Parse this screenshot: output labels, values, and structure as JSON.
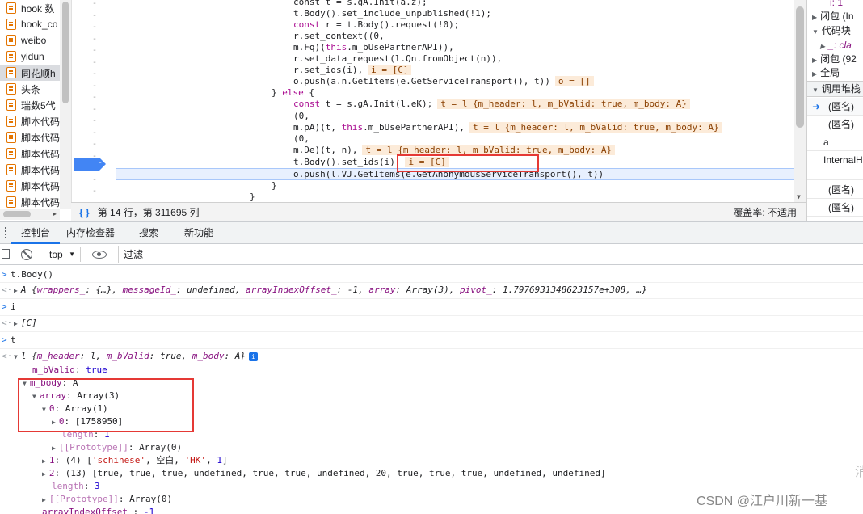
{
  "file_tree": {
    "items": [
      "hook 数",
      "hook_co",
      "weibo",
      "yidun",
      "同花顺h",
      "头条",
      "瑞数5代",
      "脚本代码",
      "脚本代码",
      "脚本代码",
      "脚本代码",
      "脚本代码",
      "脚本代码"
    ],
    "selected_index": 4
  },
  "gutter": {
    "marker": "-",
    "breakpoint_label": "-"
  },
  "code": {
    "line0": "const t = s.gA.Init(a.z);",
    "line1": "t.Body().set_include_unpublished(!1);",
    "line2_a": "const",
    "line2_b": " r = t.Body().request(!0);",
    "line3": "r.set_context((0,",
    "line4_a": "m.Fq)(",
    "line4_b": "this",
    "line4_c": ".m_bUsePartnerAPI)),",
    "line5": "r.set_data_request(l.Qn.fromObject(n)),",
    "line6": "r.set_ids(i),",
    "line6_inline": "i = [C]",
    "line7": "o.push(a.n.GetItems(e.GetServiceTransport(), t))",
    "line7_inline": "o = []",
    "line8_a": "} ",
    "line8_b": "else",
    "line8_c": " {",
    "line9_a": "const",
    "line9_b": " t = s.gA.Init(l.eK);",
    "line9_inline": "t = l {m_header: l, m_bValid: true, m_body: A}",
    "line10": "(0,",
    "line11_a": "m.pA)(t, ",
    "line11_b": "this",
    "line11_c": ".m_bUsePartnerAPI),",
    "line11_inline": "t = l {m_header: l, m_bValid: true, m_body: A}",
    "line12": "(0,",
    "line13": "m.De)(t, n),",
    "line13_inline": "t = l {m_header: l, m_bValid: true, m_body: A}",
    "line14": "t.Body().set_ids(i),",
    "line14_inline": "i = [C]",
    "line15": "o.push(l.VJ.GetItems(e.GetAnonymousServiceTransport(), t))",
    "line16": "}",
    "line17": "}"
  },
  "status_bar": {
    "position": "第 14 行，第 311695 列",
    "coverage": "覆盖率: 不适用"
  },
  "right_panel": {
    "scope_items": [
      {
        "label": "i: 1"
      },
      {
        "label": "闭包 (In"
      },
      {
        "label": "代码块"
      },
      {
        "label": "_: cla"
      },
      {
        "label": "闭包 (92"
      },
      {
        "label": "全局"
      }
    ],
    "call_stack_header": "调用堆栈",
    "call_stack": [
      "(匿名)",
      "(匿名)",
      "a",
      "InternalH",
      "(匿名)",
      "(匿名)"
    ]
  },
  "drawer_tabs": [
    "控制台",
    "内存检查器",
    "搜索",
    "新功能"
  ],
  "console_toolbar": {
    "context": "top",
    "filter_placeholder": "过滤"
  },
  "console": {
    "cmd1": "t.Body()",
    "res1_a": "A {",
    "res1_k1": "wrappers_",
    "res1_v1": ": {…}, ",
    "res1_k2": "messageId_",
    "res1_v2": ": undefined, ",
    "res1_k3": "arrayIndexOffset_",
    "res1_v3": ": -1, ",
    "res1_k4": "array",
    "res1_v4": ": Array(3), ",
    "res1_k5": "pivot_",
    "res1_v5": ": 1.7976931348623157e+308, …}",
    "cmd2": "i",
    "res2": "[C]",
    "cmd3": "t",
    "res3_a": "l {",
    "res3_k1": "m_header",
    "res3_v1": ": l, ",
    "res3_k2": "m_bValid",
    "res3_v2": ": true, ",
    "res3_k3": "m_body",
    "res3_v3": ": A}",
    "info_glyph": "i",
    "p_bvalid_k": "m_bValid",
    "p_bvalid_v": "true",
    "p_mbody_k": "m_body",
    "p_mbody_v": "A",
    "p_array_k": "array",
    "p_array_v": "Array(3)",
    "p_0_k": "0",
    "p_0_v": "Array(1)",
    "p_00_k": "0",
    "p_00_v": "[1758950]",
    "p_len1_k": "length",
    "p_len1_v": "1",
    "p_proto1_k": "[[Prototype]]",
    "p_proto1_v": "Array(0)",
    "p_1_k": "1",
    "p_1_v_a": "(4) [",
    "p_1_s1": "'schinese'",
    "p_1_v_b": ", 空白, ",
    "p_1_s2": "'HK'",
    "p_1_v_c": ", ",
    "p_1_n": "1",
    "p_1_v_d": "]",
    "p_2_k": "2",
    "p_2_v": "(13) [true, true, true, undefined, true, true, undefined, 20, true, true, true, undefined, undefined]",
    "p_len3_k": "length",
    "p_len3_v": "3",
    "p_proto2_k": "[[Prototype]]",
    "p_proto2_v": "Array(0)",
    "p_aio_k": "arrayIndexOffset_",
    "p_aio_v": "-1"
  },
  "watermark": "CSDN @江户川新一基",
  "corner_fragment": "消"
}
